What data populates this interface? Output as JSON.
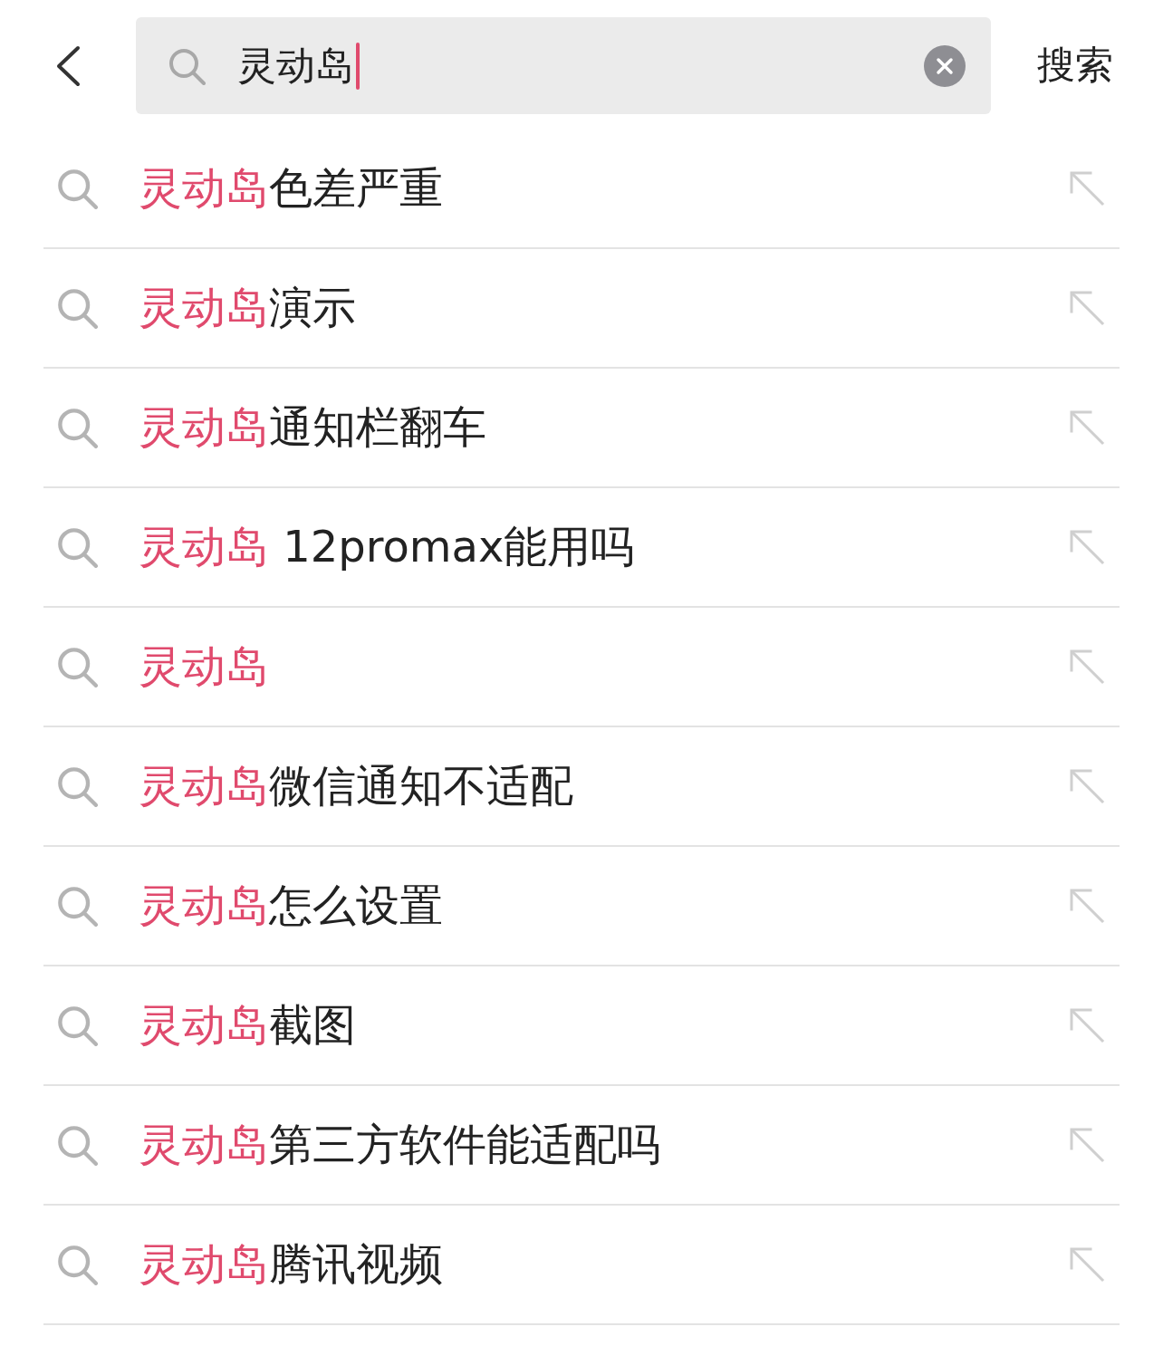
{
  "top_bar": {
    "search_field": {
      "value": "灵动岛",
      "focused": true
    },
    "search_button": "搜索"
  },
  "suggestions": [
    {
      "highlight": "灵动岛",
      "rest": "色差严重"
    },
    {
      "highlight": "灵动岛",
      "rest": "演示"
    },
    {
      "highlight": "灵动岛",
      "rest": "通知栏翻车"
    },
    {
      "highlight": "灵动岛",
      "rest": " 12promax能用吗"
    },
    {
      "highlight": "灵动岛"
    },
    {
      "highlight": "灵动岛",
      "rest": "微信通知不适配"
    },
    {
      "highlight": "灵动岛",
      "rest": "怎么设置"
    },
    {
      "highlight": "灵动岛",
      "rest": "截图"
    },
    {
      "highlight": "灵动岛",
      "rest": "第三方软件能适配吗"
    },
    {
      "highlight": "灵动岛",
      "rest": "腾讯视频"
    }
  ]
}
